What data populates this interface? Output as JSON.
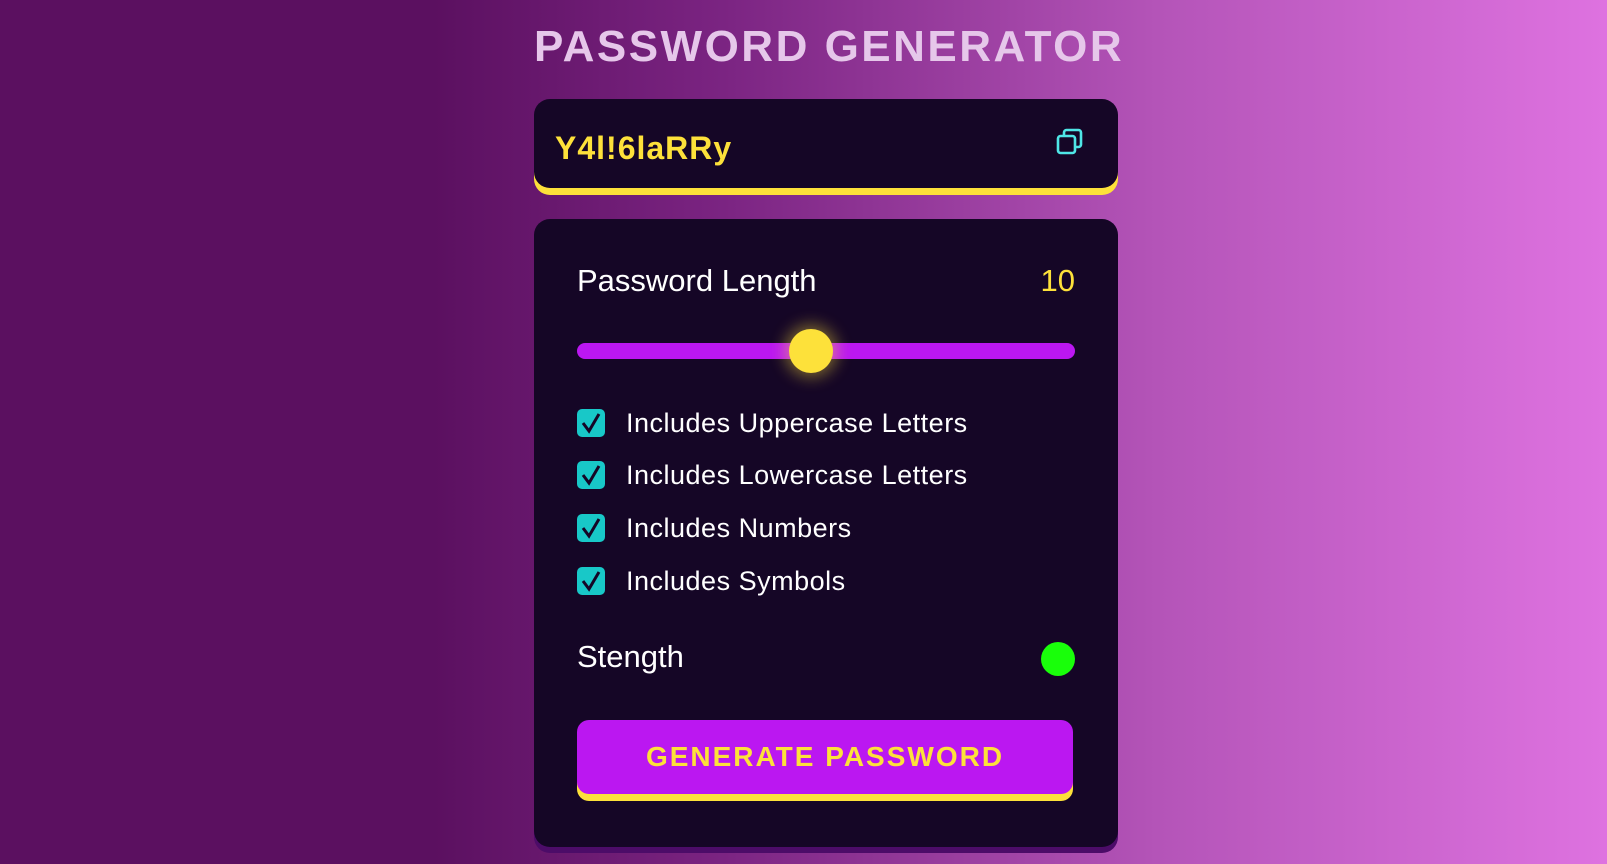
{
  "app": {
    "title": "PASSWORD GENERATOR"
  },
  "display": {
    "password": "Y4l!6laRRy",
    "copy_icon": "copy-icon"
  },
  "length": {
    "label": "Password Length",
    "value": "10",
    "slider_fraction": 0.47
  },
  "options": [
    {
      "label": "Includes Uppercase Letters",
      "checked": true
    },
    {
      "label": "Includes Lowercase Letters",
      "checked": true
    },
    {
      "label": "Includes Numbers",
      "checked": true
    },
    {
      "label": "Includes Symbols",
      "checked": true
    }
  ],
  "strength": {
    "label": "Stength",
    "indicator_color": "#19ff0a"
  },
  "generate": {
    "label": "GENERATE PASSWORD"
  },
  "colors": {
    "accent_yellow": "#fde13a",
    "accent_purple": "#bb17f1",
    "checkbox_teal": "#18c8c8",
    "panel_bg": "#150626"
  }
}
